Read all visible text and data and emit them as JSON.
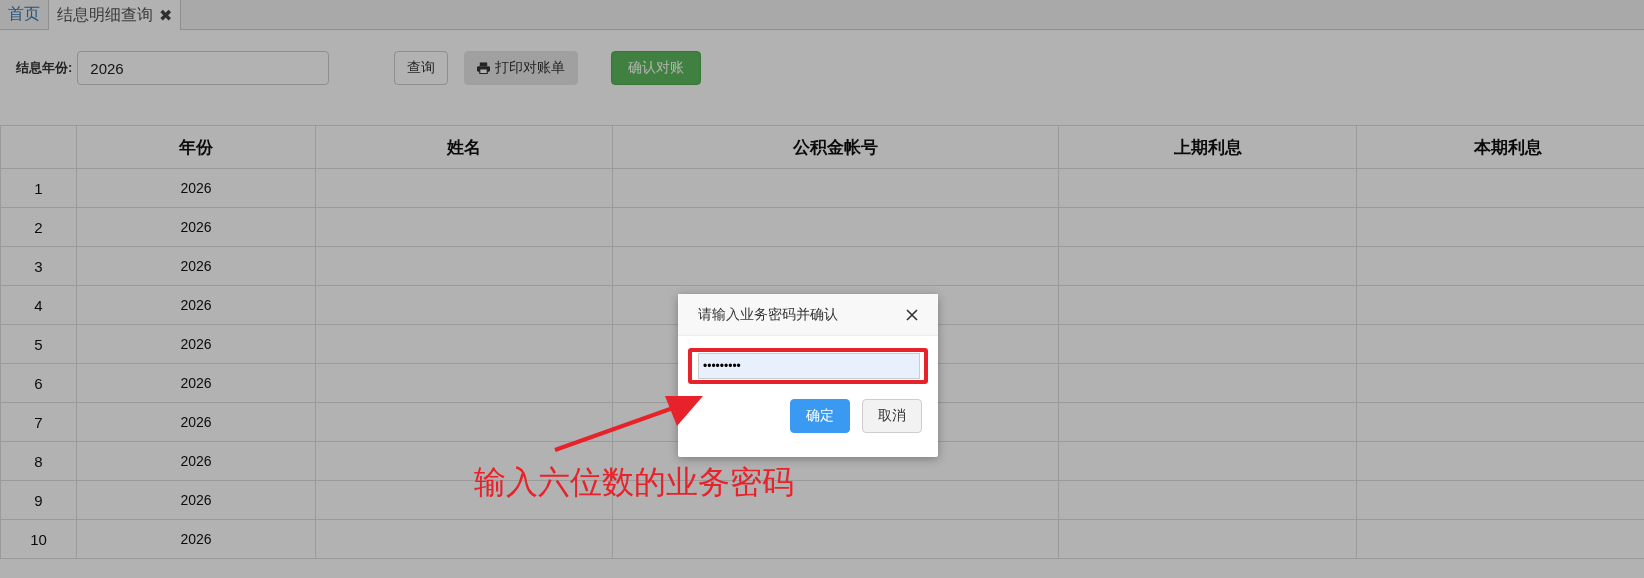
{
  "tabs": [
    {
      "label": "首页",
      "selected": false
    },
    {
      "label": "结息明细查询",
      "selected": true,
      "close_glyph": "✖"
    }
  ],
  "filter": {
    "label": "结息年份:",
    "value": "2026"
  },
  "buttons": [
    {
      "kind": "default",
      "label": "查询"
    },
    {
      "kind": "print",
      "label": "打印对账单"
    },
    {
      "kind": "success",
      "label": "确认对账"
    }
  ],
  "table": {
    "columns": [
      "年份",
      "姓名",
      "公积金帐号",
      "上期利息",
      "本期利息"
    ],
    "rows": [
      {
        "index": "1",
        "year": "2026"
      },
      {
        "index": "2",
        "year": "2026"
      },
      {
        "index": "3",
        "year": "2026"
      },
      {
        "index": "4",
        "year": "2026"
      },
      {
        "index": "5",
        "year": "2026"
      },
      {
        "index": "6",
        "year": "2026"
      },
      {
        "index": "7",
        "year": "2026"
      },
      {
        "index": "8",
        "year": "2026"
      },
      {
        "index": "9",
        "year": "2026"
      },
      {
        "index": "10",
        "year": "2026"
      }
    ]
  },
  "dialog": {
    "title": "请输入业务密码并确认",
    "password_value": "•••••••••",
    "buttons": [
      {
        "kind": "primary",
        "label": "确定"
      },
      {
        "kind": "default",
        "label": "取消"
      }
    ]
  },
  "annotation": {
    "text": "输入六位数的业务密码"
  }
}
